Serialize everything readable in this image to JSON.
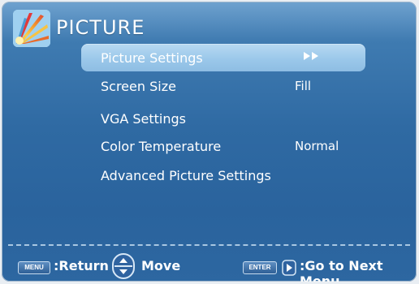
{
  "header": {
    "title": "PICTURE",
    "logo_icon": "picture-logo-icon"
  },
  "menu": {
    "items": [
      {
        "label": "Picture Settings",
        "value": "",
        "selected": true,
        "indicator_icon": "double-right-arrow-icon"
      },
      {
        "label": "Screen Size",
        "value": "Fill",
        "selected": false
      },
      {
        "label": "VGA Settings",
        "value": "",
        "selected": false
      },
      {
        "label": "Color Temperature",
        "value": "Normal",
        "selected": false
      },
      {
        "label": "Advanced Picture Settings",
        "value": "",
        "selected": false
      }
    ]
  },
  "footer": {
    "menu_key": "MENU",
    "return_label": ":Return",
    "move_label": "Move",
    "enter_key": "ENTER",
    "next_label": ":Go to Next Menu"
  },
  "colors": {
    "background_top": "#6fa2cf",
    "background_main": "#2f6aa3",
    "selection": "#9bc8ea",
    "text": "#ffffff"
  }
}
